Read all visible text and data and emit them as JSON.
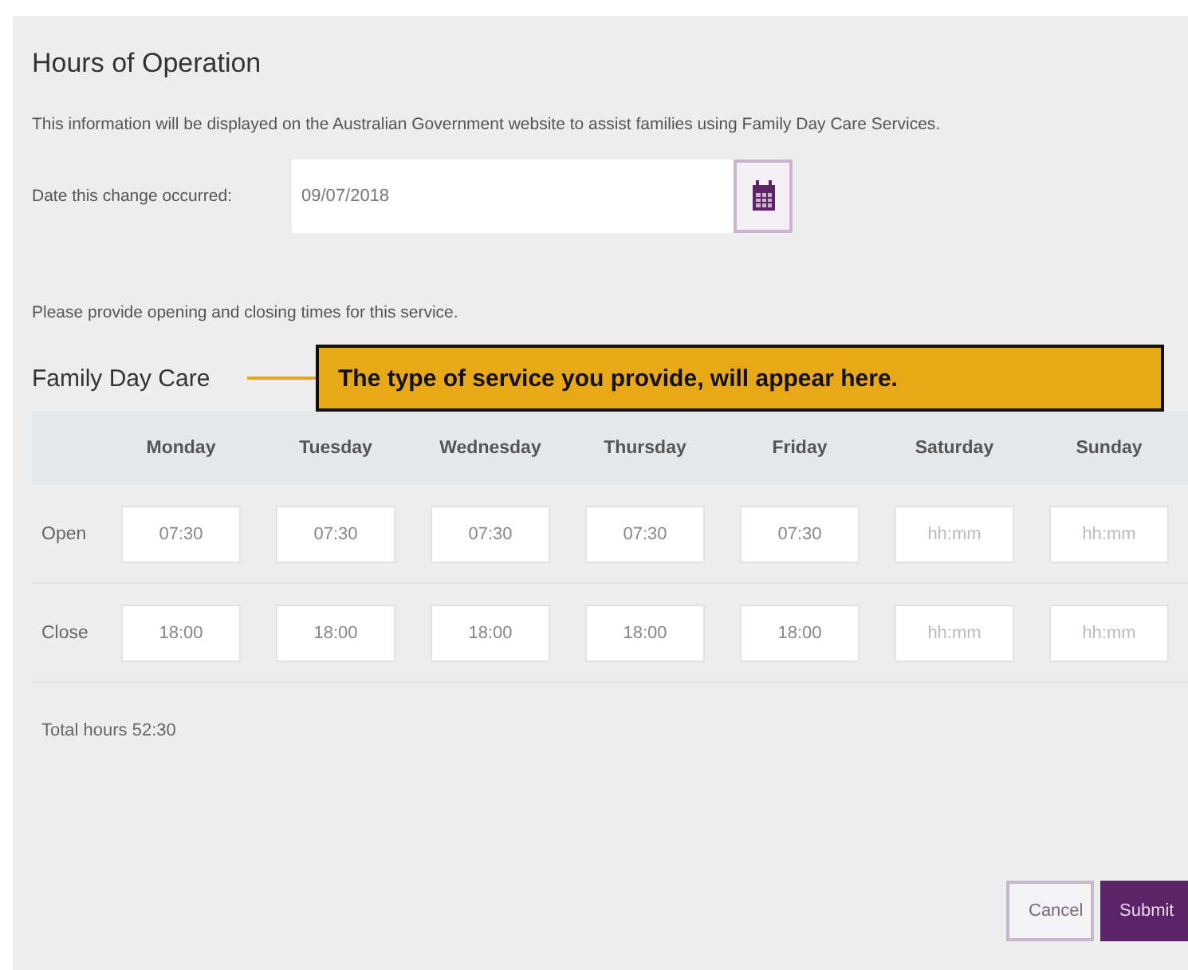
{
  "title": "Hours of Operation",
  "description": "This information will be displayed on the Australian Government website to assist families using Family Day Care Services.",
  "date_field": {
    "label": "Date this change occurred:",
    "value": "09/07/2018"
  },
  "instructions": "Please provide opening and closing times for this service.",
  "service": {
    "name": "Family Day Care",
    "callout": "The type of service you provide, will appear here."
  },
  "days": [
    "Monday",
    "Tuesday",
    "Wednesday",
    "Thursday",
    "Friday",
    "Saturday",
    "Sunday"
  ],
  "rows": [
    {
      "label": "Open",
      "cells": [
        {
          "value": "07:30"
        },
        {
          "value": "07:30"
        },
        {
          "value": "07:30"
        },
        {
          "value": "07:30"
        },
        {
          "value": "07:30"
        },
        {
          "placeholder": "hh:mm"
        },
        {
          "placeholder": "hh:mm"
        }
      ]
    },
    {
      "label": "Close",
      "cells": [
        {
          "value": "18:00"
        },
        {
          "value": "18:00"
        },
        {
          "value": "18:00"
        },
        {
          "value": "18:00"
        },
        {
          "value": "18:00"
        },
        {
          "placeholder": "hh:mm"
        },
        {
          "placeholder": "hh:mm"
        }
      ]
    }
  ],
  "total": "Total hours 52:30",
  "buttons": [
    {
      "label": "Cancel",
      "kind": "secondary"
    },
    {
      "label": "Submit",
      "kind": "primary"
    }
  ]
}
